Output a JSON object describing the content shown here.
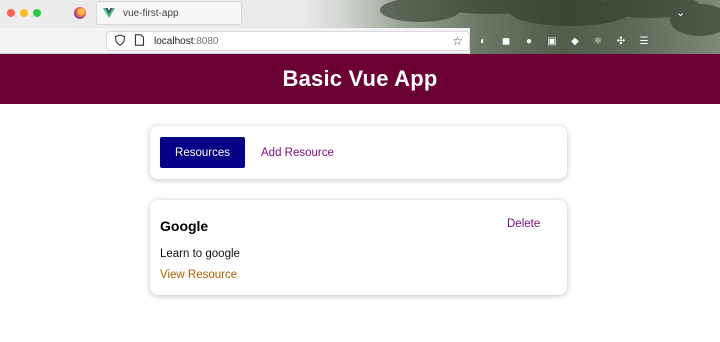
{
  "browser": {
    "tab_title": "vue-first-app",
    "url_host": "localhost",
    "url_port": ":8080"
  },
  "app": {
    "title": "Basic Vue App",
    "colors": {
      "header": "#6b0033",
      "primary_button": "#070087",
      "link": "#7a0c7a",
      "resource_link": "#b05e00"
    }
  },
  "nav": {
    "resources_label": "Resources",
    "add_resource_label": "Add Resource"
  },
  "resources": [
    {
      "title": "Google",
      "delete_label": "Delete",
      "description": "Learn to google",
      "link_label": "View Resource"
    }
  ]
}
